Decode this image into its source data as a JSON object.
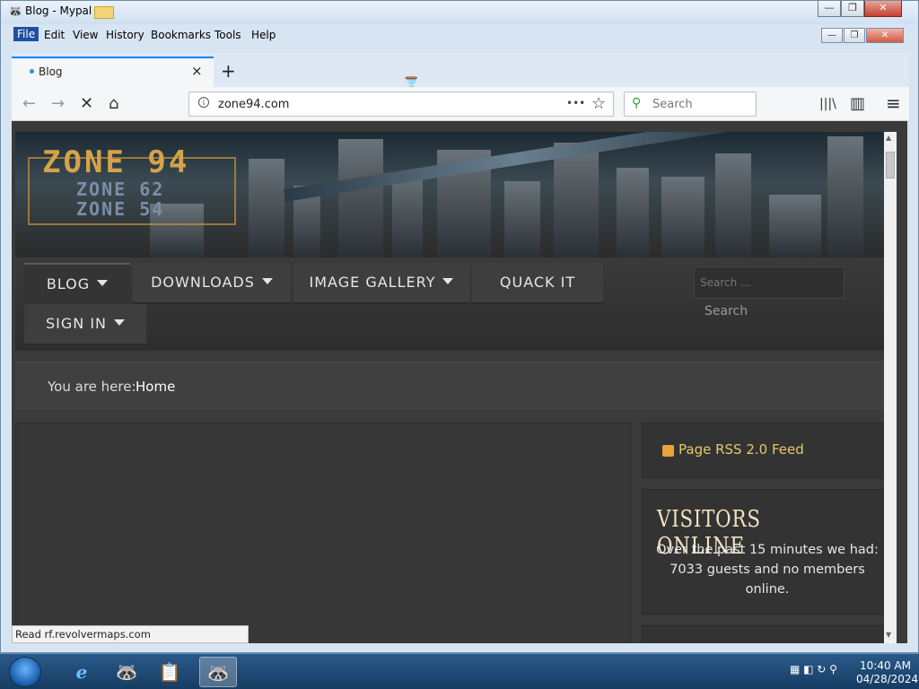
{
  "window": {
    "title": "Blog - Mypal",
    "min_label": "—",
    "max_label": "❐",
    "close_label": "✕"
  },
  "menubar": {
    "items": [
      "File",
      "Edit",
      "View",
      "History",
      "Bookmarks",
      "Tools",
      "Help"
    ]
  },
  "tab": {
    "label": "Blog",
    "close": "×",
    "new_tab": "+"
  },
  "nav": {
    "back": "←",
    "forward": "→",
    "stop": "✕",
    "home": "⌂",
    "url": "zone94.com",
    "page_actions": "•••",
    "bookmark_star": "☆",
    "search_placeholder": "Search",
    "library": "|||\\",
    "sidebar": "▥",
    "menu": "≡"
  },
  "site": {
    "logo_main": "ZONE 94",
    "logo_sub1": "ZONE 62",
    "logo_sub2": "ZONE 54",
    "menu": [
      {
        "label": "BLOG",
        "has_caret": true,
        "active": true
      },
      {
        "label": "DOWNLOADS",
        "has_caret": true,
        "active": false
      },
      {
        "label": "IMAGE GALLERY",
        "has_caret": true,
        "active": false
      },
      {
        "label": "QUACK IT",
        "has_caret": false,
        "active": false
      },
      {
        "label": "SIGN IN",
        "has_caret": true,
        "active": false
      }
    ],
    "search_placeholder": "Search ...",
    "search_button": "Search",
    "breadcrumb_label": "You are here:",
    "breadcrumb_home": "Home",
    "rss_label": "Page RSS 2.0 Feed",
    "visitors_title": "VISITORS ONLINE",
    "visitors_text": "Over the past 15 minutes we had: 7033 guests and no members online."
  },
  "status": {
    "text": "Read rf.revolvermaps.com"
  },
  "taskbar": {
    "apps": [
      "e",
      "🦝",
      "📋",
      "🦝"
    ],
    "time": "10:40 AM",
    "date": "04/28/2024"
  }
}
